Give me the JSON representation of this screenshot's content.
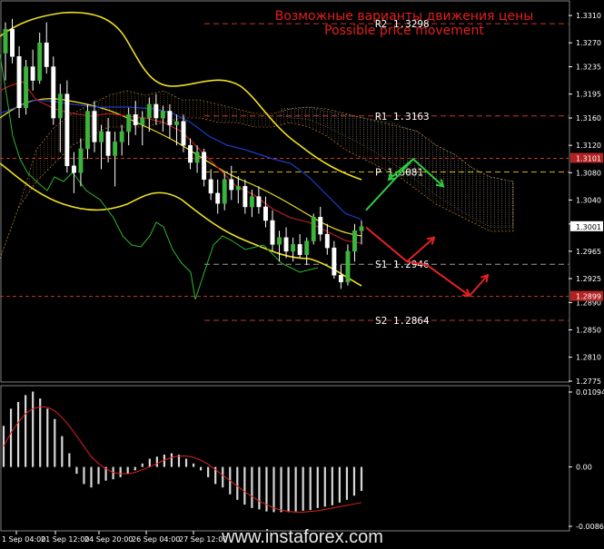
{
  "chart_data": {
    "type": "candlestick",
    "title": "Возможные варианты движения цены",
    "subtitle": "Possible price movement",
    "watermark": "www.instaforex.com",
    "price_axis": {
      "ylim": [
        1.2775,
        1.333
      ],
      "ticks": [
        "1.3310",
        "1.3270",
        "1.3235",
        "1.3195",
        "1.3160",
        "1.3120",
        "1.3080",
        "1.3040",
        "1.3005",
        "1.2965",
        "1.2925",
        "1.2890",
        "1.2850",
        "1.2810",
        "1.2775"
      ]
    },
    "time_labels": [
      "1 Sep 04:00",
      "21 Sep 12:00",
      "24 Sep 20:00",
      "26 Sep 04:00",
      "27 Sep 12:00"
    ],
    "levels": [
      {
        "name": "R2",
        "value": 1.3298,
        "label": "R2 1.3298",
        "color": "#c0392b"
      },
      {
        "name": "R1",
        "value": 1.3163,
        "label": "R1 1.3163",
        "color": "#c0392b"
      },
      {
        "name": "P",
        "value": 1.3081,
        "label": "P 1.3081",
        "color": "#d4b000"
      },
      {
        "name": "S1",
        "value": 1.2946,
        "label": "S1 1.2946",
        "color": "#9a9a9a"
      },
      {
        "name": "S2",
        "value": 1.2864,
        "label": "S2 1.2864",
        "color": "#c0392b"
      }
    ],
    "price_tags": [
      {
        "label": "1.3101",
        "value": 1.3101,
        "bg": "#b22222"
      },
      {
        "label": "1.3001",
        "value": 1.3001,
        "bg": "#ffffff"
      },
      {
        "label": "1.2899",
        "value": 1.2899,
        "bg": "#b22222"
      }
    ],
    "candles": [
      [
        1.3255,
        1.33,
        1.3215,
        1.329
      ],
      [
        1.329,
        1.3305,
        1.324,
        1.325
      ],
      [
        1.325,
        1.3265,
        1.316,
        1.3175
      ],
      [
        1.3175,
        1.3245,
        1.3165,
        1.3235
      ],
      [
        1.3235,
        1.326,
        1.32,
        1.3215
      ],
      [
        1.3215,
        1.3285,
        1.321,
        1.327
      ],
      [
        1.327,
        1.33,
        1.3225,
        1.3235
      ],
      [
        1.3235,
        1.325,
        1.315,
        1.316
      ],
      [
        1.316,
        1.321,
        1.311,
        1.3195
      ],
      [
        1.3195,
        1.3215,
        1.308,
        1.309
      ],
      [
        1.309,
        1.311,
        1.305,
        1.308
      ],
      [
        1.308,
        1.313,
        1.306,
        1.3115
      ],
      [
        1.3115,
        1.318,
        1.31,
        1.317
      ],
      [
        1.317,
        1.3185,
        1.311,
        1.3125
      ],
      [
        1.3125,
        1.315,
        1.3085,
        1.314
      ],
      [
        1.314,
        1.316,
        1.3095,
        1.3105
      ],
      [
        1.3105,
        1.314,
        1.306,
        1.3125
      ],
      [
        1.3125,
        1.315,
        1.3105,
        1.314
      ],
      [
        1.314,
        1.3175,
        1.312,
        1.3165
      ],
      [
        1.3165,
        1.3185,
        1.3135,
        1.315
      ],
      [
        1.315,
        1.317,
        1.312,
        1.316
      ],
      [
        1.316,
        1.319,
        1.314,
        1.318
      ],
      [
        1.318,
        1.3195,
        1.315,
        1.316
      ],
      [
        1.316,
        1.3178,
        1.314,
        1.317
      ],
      [
        1.317,
        1.318,
        1.313,
        1.315
      ],
      [
        1.315,
        1.3165,
        1.312,
        1.3155
      ],
      [
        1.3155,
        1.3165,
        1.311,
        1.312
      ],
      [
        1.312,
        1.313,
        1.3085,
        1.3095
      ],
      [
        1.3095,
        1.312,
        1.308,
        1.311
      ],
      [
        1.311,
        1.3115,
        1.306,
        1.307
      ],
      [
        1.307,
        1.3085,
        1.304,
        1.305
      ],
      [
        1.305,
        1.307,
        1.302,
        1.3035
      ],
      [
        1.3035,
        1.308,
        1.3025,
        1.307
      ],
      [
        1.307,
        1.309,
        1.304,
        1.3055
      ],
      [
        1.3055,
        1.3075,
        1.3035,
        1.306
      ],
      [
        1.306,
        1.307,
        1.302,
        1.303
      ],
      [
        1.303,
        1.3055,
        1.3015,
        1.3045
      ],
      [
        1.3045,
        1.306,
        1.302,
        1.303
      ],
      [
        1.303,
        1.3045,
        1.3,
        1.301
      ],
      [
        1.301,
        1.3025,
        1.2965,
        1.2975
      ],
      [
        1.2975,
        1.2995,
        1.295,
        1.2985
      ],
      [
        1.2985,
        1.3,
        1.2955,
        1.2965
      ],
      [
        1.2965,
        1.2985,
        1.295,
        1.2975
      ],
      [
        1.2975,
        1.299,
        1.2955,
        1.296
      ],
      [
        1.296,
        1.2985,
        1.2945,
        1.298
      ],
      [
        1.298,
        1.302,
        1.2975,
        1.3015
      ],
      [
        1.3015,
        1.303,
        1.298,
        1.299
      ],
      [
        1.299,
        1.3005,
        1.296,
        1.297
      ],
      [
        1.297,
        1.298,
        1.2925,
        1.293
      ],
      [
        1.293,
        1.2945,
        1.291,
        1.292
      ],
      [
        1.292,
        1.2975,
        1.2915,
        1.2965
      ],
      [
        1.2965,
        1.3005,
        1.295,
        1.2995
      ],
      [
        1.2995,
        1.301,
        1.2975,
        1.3001
      ]
    ],
    "scenarios": [
      {
        "color": "#2ecc40",
        "points": [
          [
            1.3005,
            1.3005
          ],
          [
            1.304,
            1.304
          ],
          [
            1.31,
            1.31
          ],
          [
            1.306,
            1.306
          ]
        ],
        "head": [
          1.3085,
          1.3065
        ]
      },
      {
        "color": "#e52222",
        "points": [
          [
            1.3005,
            1.3005
          ],
          [
            1.295,
            1.295
          ],
          [
            1.298,
            1.298
          ]
        ],
        "extra": [
          [
            1.295,
            1.29
          ],
          [
            1.29,
            1.293
          ]
        ]
      }
    ],
    "macd": {
      "ylim": [
        -0.00867,
        0.01094
      ],
      "ticks": [
        "0.01094",
        "0.00",
        "-0.00867"
      ],
      "histogram": [
        0.006,
        0.0085,
        0.0095,
        0.0105,
        0.011,
        0.01,
        0.0085,
        0.007,
        0.0045,
        0.002,
        -0.001,
        -0.0025,
        -0.003,
        -0.0025,
        -0.002,
        -0.0018,
        -0.0015,
        -0.001,
        -0.0005,
        0.0005,
        0.0012,
        0.0015,
        0.0018,
        0.002,
        0.0018,
        0.0012,
        0.0005,
        -0.0005,
        -0.0015,
        -0.0025,
        -0.003,
        -0.004,
        -0.0048,
        -0.0055,
        -0.006,
        -0.0062,
        -0.0065,
        -0.0066,
        -0.0066,
        -0.0066,
        -0.0065,
        -0.0064,
        -0.0063,
        -0.006,
        -0.0058,
        -0.0056,
        -0.0052,
        -0.0048,
        -0.0042,
        -0.0035
      ],
      "signal": [
        0.003,
        0.005,
        0.0065,
        0.0078,
        0.0085,
        0.0088,
        0.0087,
        0.0082,
        0.0072,
        0.006,
        0.0045,
        0.003,
        0.0015,
        0.0005,
        -0.0003,
        -0.0008,
        -0.001,
        -0.001,
        -0.0008,
        -0.0004,
        0.0,
        0.0005,
        0.001,
        0.0014,
        0.0016,
        0.0016,
        0.0014,
        0.001,
        0.0004,
        -0.0004,
        -0.0012,
        -0.002,
        -0.0028,
        -0.0036,
        -0.0043,
        -0.005,
        -0.0055,
        -0.006,
        -0.0063,
        -0.0065,
        -0.0066,
        -0.0066,
        -0.0065,
        -0.0064,
        -0.0062,
        -0.006,
        -0.0058,
        -0.0056,
        -0.0054,
        -0.0052
      ]
    }
  }
}
